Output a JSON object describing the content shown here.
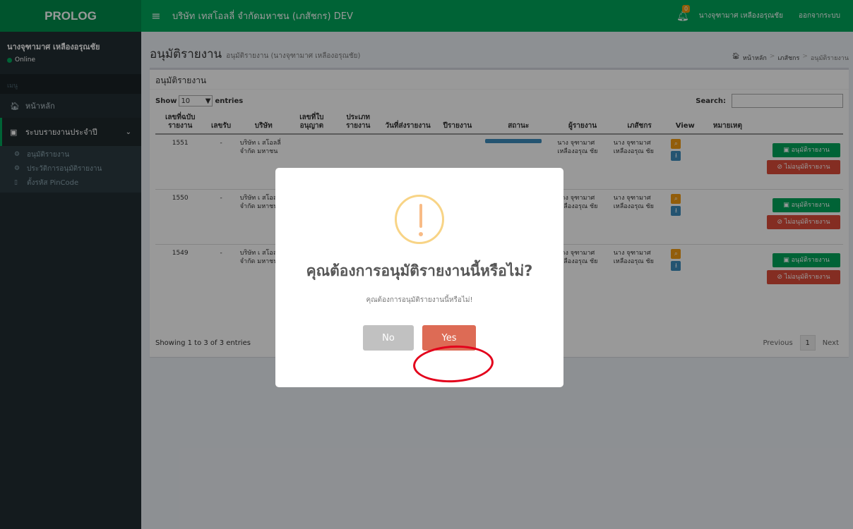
{
  "header": {
    "logo": "PROLOG",
    "menu_icon": "≡",
    "company": "บริษัท เทสโอลลี่ จำกัดมหาชน (เภสัชกร) DEV",
    "notification_count": "0",
    "user": "นางจุฑามาศ เหลืองอรุณชัย",
    "logout": "ออกจากระบบ"
  },
  "sidebar": {
    "user_name": "นางจุฑามาศ เหลืองอรุณชัย",
    "status": "Online",
    "menu_header": "เมนู",
    "home": "หน้าหลัก",
    "reports_menu": "ระบบรายงานประจำปี",
    "sub_items": [
      "อนุมัติรายงาน",
      "ประวัติการอนุมัติรายงาน",
      "ตั้งรหัส PinCode"
    ]
  },
  "content": {
    "title": "อนุมัติรายงาน",
    "subtitle": "อนุมัติรายงาน (นางจุฑามาศ เหลืองอรุณชัย)",
    "breadcrumb": [
      "หน้าหลัก",
      "เภสัชกร",
      "อนุมัติรายงาน"
    ]
  },
  "box": {
    "title": "อนุมัติรายงาน",
    "show": "Show",
    "entries_value": "10",
    "entries": "entries",
    "search_label": "Search:"
  },
  "table": {
    "headers": [
      "เลขที่ฉบับรายงาน",
      "เลขรับ",
      "บริษัท",
      "เลขที่ใบอนุญาต",
      "ประเภทรายงาน",
      "วันที่ส่งรายงาน",
      "ปีรายงาน",
      "สถานะ",
      "ผู้รายงาน",
      "เภสัชกร",
      "View",
      "หมายเหตุ"
    ],
    "rows": [
      {
        "report_no": "1551",
        "receive_no": "-",
        "company": "บริษัท เ สโอลลี่ จำกัด มหาชน",
        "reporter": "นาง จุฑามาศ เหลืองอรุณ ชัย",
        "pharmacist": "นาง จุฑามาศ เหลืองอรุณ ชัย"
      },
      {
        "report_no": "1550",
        "receive_no": "-",
        "company": "บริษัท เ สโอลลี่ จำกัด มหาชน",
        "reporter": "นาง จุฑามาศ เหลืองอรุณ ชัย",
        "pharmacist": "นาง จุฑามาศ เหลืองอรุณ ชัย"
      },
      {
        "report_no": "1549",
        "receive_no": "-",
        "company": "บริษัท เ สโอลลี่ จำกัด มหาชน",
        "reporter": "นาง จุฑามาศ เหลืองอรุณ ชัย",
        "pharmacist": "นาง จุฑามาศ เหลืองอรุณ ชัย"
      }
    ],
    "approve_label": "อนุมัติรายงาน",
    "reject_label": "ไม่อนุมัติรายงาน",
    "info": "Showing 1 to 3 of 3 entries",
    "previous": "Previous",
    "page": "1",
    "next": "Next"
  },
  "modal": {
    "title": "คุณต้องการอนุมัติรายงานนี้หรือไม่?",
    "text": "คุณต้องการอนุมัติรายงานนี้หรือไม่!",
    "no": "No",
    "yes": "Yes"
  }
}
